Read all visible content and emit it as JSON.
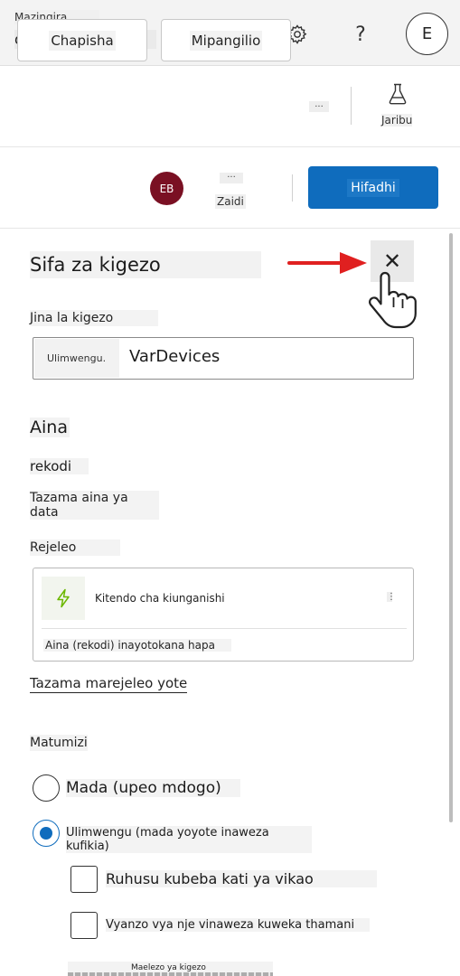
{
  "topbar": {
    "environment_label": "Mazingira",
    "environment_name": "dev-cs-academy",
    "help_glyph": "?",
    "user_initial": "E"
  },
  "commandbar": {
    "publish_label": "Chapisha",
    "settings_label": "Mipangilio",
    "overflow_label": "...",
    "test_label": "Jaribu"
  },
  "actionbar": {
    "user_initials": "EB",
    "more_dots": "...",
    "more_label": "Zaidi",
    "save_label": "Hifadhi"
  },
  "panel": {
    "title": "Sifa za kigezo",
    "close_glyph": "✕",
    "name_label": "Jina la kigezo",
    "name_prefix": "Ulimwengu.",
    "name_value": "VarDevices",
    "type_heading": "Aina",
    "type_value": "rekodi",
    "view_type_link": "Tazama aina ya data",
    "reference_label": "Rejeleo",
    "reference": {
      "name": "Kitendo cha kiunganishi",
      "menu_glyph": "⋮",
      "subtitle": "Aina (rekodi) inayotokana hapa"
    },
    "view_refs_link": "Tazama marejeleo yote",
    "usage_label": "Matumizi",
    "scope_options": [
      {
        "label": "Mada (upeo mdogo)",
        "selected": false
      },
      {
        "label": "Ulimwengu (mada yoyote inaweza kufikia)",
        "selected": true
      }
    ],
    "checkboxes": [
      {
        "label": "Ruhusu kubeba kati ya vikao",
        "checked": false
      },
      {
        "label": "Vyanzo vya nje vinaweza kuweka thamani",
        "checked": false
      }
    ],
    "description_label": "Maelezo ya kigezo"
  },
  "colors": {
    "accent": "#0f6cbd",
    "avatar": "#7a1023",
    "arrow": "#e02020",
    "flow_icon": "#6bb700"
  },
  "icons": {
    "settings": "gear-icon",
    "test": "flask-icon",
    "reference": "lightning-icon",
    "pointer": "hand-pointer-icon",
    "annotation": "red-arrow-icon"
  }
}
